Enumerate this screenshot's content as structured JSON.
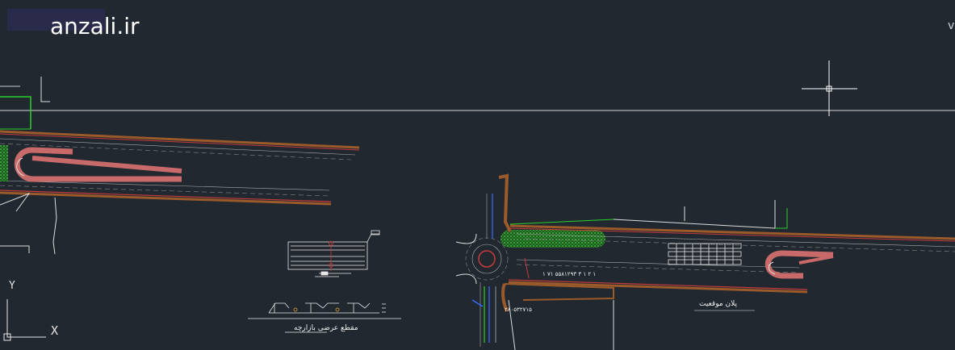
{
  "brand": {
    "text": "anzali.ir"
  },
  "edge_text": "v",
  "ucs": {
    "y_label": "Y",
    "x_label": "X"
  },
  "labels": {
    "section_title": "مقطع عرضی بازارچه",
    "plan_title": "پلان موقعیت",
    "road_note": "۱ ۲ ۱ ۳ ۵۵۸۱۲۹۳ ۷۱ ۱",
    "road_note_2": "۲۸۰۵۳۲۷۱۵"
  },
  "colors": {
    "background": "#212830",
    "line_white": "#e8e8e8",
    "road_red": "#b23a3a",
    "road_brown": "#8a4a2a",
    "green": "#2bd12b",
    "hatch_green": "#2e8b2e",
    "blue": "#3a6bff",
    "parking_pink": "#c86a6a"
  }
}
